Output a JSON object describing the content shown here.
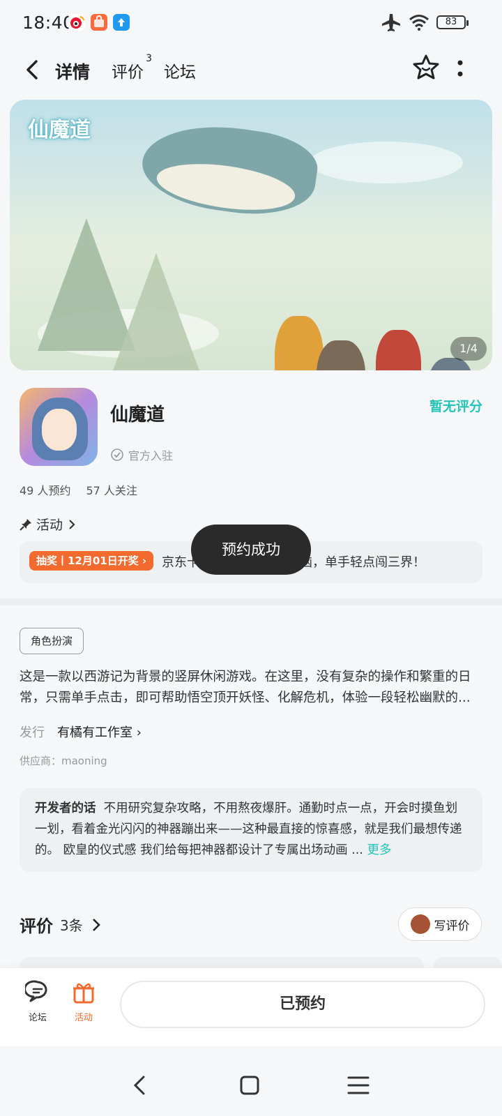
{
  "status_bar": {
    "time": "18:40",
    "battery": "83"
  },
  "header": {
    "tabs": [
      {
        "label": "详情",
        "active": true
      },
      {
        "label": "评价",
        "badge": "3"
      },
      {
        "label": "论坛"
      }
    ]
  },
  "banner": {
    "logo_text": "仙魔道",
    "page_indicator": "1/4"
  },
  "app": {
    "name": "仙魔道",
    "official_label": "官方入驻",
    "rating": "暂无评分",
    "reservations": "49 人预约",
    "followers": "57 人关注"
  },
  "activity": {
    "label": "活动",
    "badge": "抽奖丨12月01日开奖 ›",
    "text": "京东卡等你来拿！告别烦恼，单手轻点闯三界！"
  },
  "toast": "预约成功",
  "genre_tag": "角色扮演",
  "description": "这是一款以西游记为背景的竖屏休闲游戏。在这里，没有复杂的操作和繁重的日常，只需单手点击，即可帮助悟空顶开妖怪、化解危机，体验一段轻松幽默的...",
  "publisher": {
    "label": "发行",
    "value": "有橘有工作室 ›"
  },
  "supplier": "供应商：maoning",
  "developer_note": {
    "title": "开发者的话",
    "text": "不用研究复杂攻略，不用熬夜爆肝。通勤时点一点，开会时摸鱼划一划，看着金光闪闪的神器蹦出来——这种最直接的惊喜感，就是我们最想传递的。 欧皇的仪式感 我们给每把神器都设计了专属出场动画 ...",
    "more": "更多"
  },
  "reviews": {
    "title": "评价",
    "count": "3条",
    "write_label": "写评价"
  },
  "bottom_bar": {
    "forum_label": "论坛",
    "activity_label": "活动",
    "reserve_button": "已预约"
  },
  "colors": {
    "accent": "#24c4b6",
    "orange": "#f26a2e",
    "toast_bg": "#2a2a2a"
  }
}
